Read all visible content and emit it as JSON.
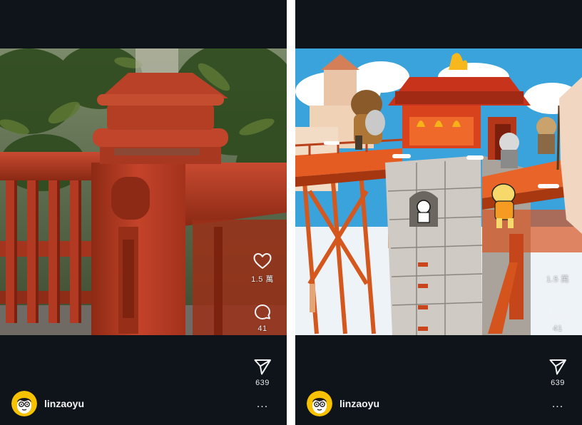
{
  "posts": [
    {
      "username": "linzaoyu",
      "likes": "1.5 萬",
      "comments": "41",
      "shares": "639",
      "more": "...",
      "media_kind": "photo-red-railing"
    },
    {
      "username": "linzaoyu",
      "likes": "1.5 萬",
      "comments": "41",
      "shares": "639",
      "more": "...",
      "media_kind": "illustration-red-bridge-castle"
    }
  ],
  "icons": {
    "like": "heart-icon",
    "comment": "comment-bubble-icon",
    "share": "paper-plane-icon",
    "more": "more-dots-icon"
  },
  "colors": {
    "background": "#0f141a",
    "text": "#e9ecef",
    "railing_red": "#b5361f",
    "avatar_yellow": "#f6c200"
  }
}
